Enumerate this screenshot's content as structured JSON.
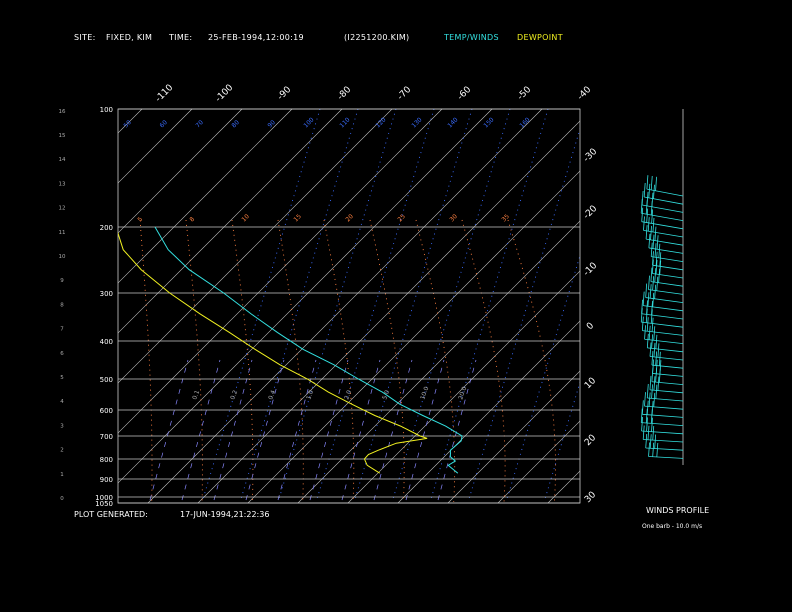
{
  "header": {
    "site_label": "SITE:",
    "site_value": "FIXED, KIM",
    "time_label": "TIME:",
    "time_value": "25-FEB-1994,12:00:19",
    "file_id": "(I2251200.KIM)",
    "temp_winds": "TEMP/WINDS",
    "dewpoint": "DEWPOINT"
  },
  "footer": {
    "plot_generated_label": "PLOT GENERATED:",
    "plot_generated_value": "17-JUN-1994,21:22:36",
    "winds_profile": "WINDS PROFILE",
    "barb_note": "One barb - 10.0 m/s"
  },
  "colors": {
    "background": "#000000",
    "temp": "#33e0e0",
    "dewpoint": "#f0f020",
    "isobar": "#c8c8c8",
    "isotherm": "#c8c8c8",
    "dry_adiabat": "#3a6cff",
    "moist_adiabat": "#ff8040",
    "mixing_ratio": "#8888ff"
  },
  "chart_data": {
    "type": "line",
    "x_axis_label_values": [
      -110,
      -100,
      -90,
      -80,
      -70,
      -60,
      -50,
      -40,
      -30,
      -20,
      -10,
      0,
      10,
      20,
      30
    ],
    "pressure_levels": [
      100,
      200,
      300,
      400,
      500,
      600,
      700,
      800,
      900,
      1000,
      1050
    ],
    "height_ticks_km": [
      0,
      1,
      2,
      3,
      4,
      5,
      6,
      7,
      8,
      9,
      10,
      11,
      12,
      13,
      14,
      15,
      16
    ],
    "dry_adiabat_labels": [
      "50",
      "60",
      "70",
      "80",
      "90",
      "100",
      "110",
      "120",
      "130",
      "140",
      "150",
      "160"
    ],
    "moist_labels": [
      "5",
      "8",
      "10",
      "15",
      "20",
      "25",
      "30",
      "35"
    ],
    "mixing_labels": [
      "0.1",
      "0.2",
      "0.4",
      "1.0",
      "2.0",
      "5.0",
      "10.0",
      "20.0"
    ],
    "series": [
      {
        "name": "TEMP/WINDS",
        "points": [
          [
            200,
            -65
          ],
          [
            230,
            -64
          ],
          [
            260,
            -60
          ],
          [
            300,
            -52
          ],
          [
            340,
            -46
          ],
          [
            380,
            -40
          ],
          [
            420,
            -34
          ],
          [
            460,
            -26
          ],
          [
            500,
            -20
          ],
          [
            540,
            -14
          ],
          [
            580,
            -10
          ],
          [
            620,
            -4
          ],
          [
            660,
            2
          ],
          [
            700,
            6
          ],
          [
            720,
            5
          ],
          [
            760,
            0
          ],
          [
            790,
            -1
          ],
          [
            810,
            0
          ],
          [
            830,
            -3
          ],
          [
            850,
            -2
          ],
          [
            870,
            -1
          ]
        ]
      },
      {
        "name": "DEWPOINT",
        "points": [
          [
            200,
            -78
          ],
          [
            230,
            -79
          ],
          [
            260,
            -76
          ],
          [
            300,
            -70
          ],
          [
            340,
            -63
          ],
          [
            380,
            -56
          ],
          [
            420,
            -50
          ],
          [
            460,
            -44
          ],
          [
            500,
            -37
          ],
          [
            540,
            -32
          ],
          [
            580,
            -26
          ],
          [
            620,
            -20
          ],
          [
            660,
            -13
          ],
          [
            700,
            -8
          ],
          [
            710,
            -6
          ],
          [
            730,
            -17
          ],
          [
            760,
            -24
          ],
          [
            780,
            -28
          ],
          [
            800,
            -30
          ],
          [
            830,
            -30
          ],
          [
            870,
            -27
          ]
        ]
      }
    ],
    "wind_profile_barbs": 33
  }
}
